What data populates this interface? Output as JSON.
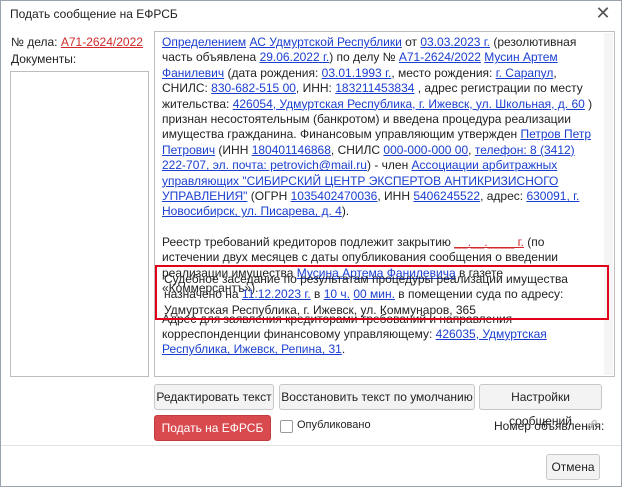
{
  "window": {
    "title": "Подать сообщение на ЕФРСБ"
  },
  "case": {
    "label": "№ дела:",
    "number": "А71-2624/2022"
  },
  "documents": {
    "label": "Документы:"
  },
  "text": {
    "p1": [
      {
        "t": "Определением",
        "link": true
      },
      {
        "t": " "
      },
      {
        "t": "АС Удмуртской Республики",
        "link": true
      },
      {
        "t": " от "
      },
      {
        "t": "03.03.2023 г.",
        "link": true
      },
      {
        "t": " (резолютивная часть объявлена "
      },
      {
        "t": "29.06.2022 г.",
        "link": true
      },
      {
        "t": ") по делу № "
      },
      {
        "t": "А71-2624/2022",
        "link": true
      },
      {
        "t": " "
      },
      {
        "t": "Мусин Артем Фанилевич",
        "link": true
      },
      {
        "t": " (дата рождения: "
      },
      {
        "t": "03.01.1993 г.",
        "link": true
      },
      {
        "t": ", место рождения: "
      },
      {
        "t": "г. Сарапул",
        "link": true
      },
      {
        "t": ", СНИЛС: "
      },
      {
        "t": "830-682-515 00",
        "link": true
      },
      {
        "t": ", ИНН: "
      },
      {
        "t": "183211453834",
        "link": true
      },
      {
        "t": " , адрес регистрации по месту жительства: "
      },
      {
        "t": "426054, Удмуртская Республика, г. Ижевск, ул. Школьная, д. 60",
        "link": true
      },
      {
        "t": " ) признан несостоятельным (банкротом) и введена процедура реализации имущества гражданина. Финансовым управляющим утвержден "
      },
      {
        "t": "Петров Петр Петрович",
        "link": true
      },
      {
        "t": " (ИНН "
      },
      {
        "t": "180401146868",
        "link": true
      },
      {
        "t": ", СНИЛС "
      },
      {
        "t": "000-000-000 00",
        "link": true
      },
      {
        "t": ", "
      },
      {
        "t": "телефон: 8 (3412) 222-707, эл. почта: petrovich@mail.ru",
        "link": true
      },
      {
        "t": ") - член "
      },
      {
        "t": "Ассоциации арбитражных управляющих \"СИБИРСКИЙ ЦЕНТР ЭКСПЕРТОВ АНТИКРИЗИСНОГО УПРАВЛЕНИЯ\"",
        "link": true
      },
      {
        "t": " (ОГРН "
      },
      {
        "t": "1035402470036",
        "link": true
      },
      {
        "t": ", ИНН "
      },
      {
        "t": "5406245522",
        "link": true
      },
      {
        "t": ", адрес: "
      },
      {
        "t": "630091, г. Новосибирск, ул. Писарева, д. 4",
        "link": true
      },
      {
        "t": ")."
      }
    ],
    "p2": [
      {
        "t": "Реестр требований кредиторов подлежит закрытию "
      },
      {
        "t": "__.__.____ г.",
        "link": true,
        "red": true
      },
      {
        "t": " (по истечении двух месяцев с даты опубликования сообщения о введении реализации имущества "
      },
      {
        "t": "Мусина Артема Фанилевича",
        "link": true
      },
      {
        "t": " в газете «Коммерсантъ»)."
      }
    ],
    "p3": [
      {
        "t": "Адрес для заявления кредиторами требований и направления корреспонденции финансовому управляющему: "
      },
      {
        "t": "426035, Удмуртская Республика, Ижевск, Репина, 31",
        "link": true
      },
      {
        "t": "."
      }
    ],
    "p4": [
      {
        "t": "Судебное заседание по результатам процедуры реализации имущества назначено на "
      },
      {
        "t": "11.12.2023 г.",
        "link": true
      },
      {
        "t": " в "
      },
      {
        "t": "10 ч.",
        "link": true
      },
      {
        "t": " "
      },
      {
        "t": "00 мин.",
        "link": true
      },
      {
        "t": " в помещении суда по адресу: Удмуртская Республика, г. Ижевск, ул. Коммунаров, 365"
      }
    ]
  },
  "buttons": {
    "edit": "Редактировать текст",
    "restore": "Восстановить текст по умолчанию",
    "settings": "Настройки сообщений",
    "submit": "Подать на ЕФРСБ",
    "cancel": "Отмена"
  },
  "published": {
    "label": "Опубликовано",
    "checked": false
  },
  "notice_number": {
    "label": "Номер объявления:"
  }
}
